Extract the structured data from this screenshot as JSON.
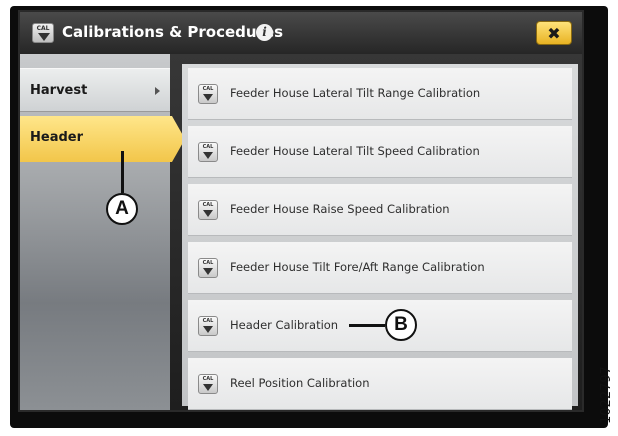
{
  "window": {
    "title": "Calibrations & Procedures",
    "info_icon": "info-icon",
    "close_label": "✖"
  },
  "sidebar": {
    "items": [
      {
        "label": "Harvest",
        "has_submenu": true,
        "selected": false
      },
      {
        "label": "Header",
        "has_submenu": false,
        "selected": true
      }
    ]
  },
  "procedures": {
    "icon_label": "CAL",
    "items": [
      {
        "label": "Feeder House Lateral Tilt Range Calibration"
      },
      {
        "label": "Feeder House Lateral Tilt Speed Calibration"
      },
      {
        "label": "Feeder House Raise Speed Calibration"
      },
      {
        "label": "Feeder House Tilt Fore/Aft Range Calibration"
      },
      {
        "label": "Header Calibration"
      },
      {
        "label": "Reel Position Calibration"
      }
    ]
  },
  "annotations": {
    "callout_a": "A",
    "callout_b": "B",
    "figure_number": "1022797"
  },
  "colors": {
    "selected_tab": "#f2c64a",
    "close_button": "#f0c030",
    "title_bar": "#2e2e2e"
  }
}
